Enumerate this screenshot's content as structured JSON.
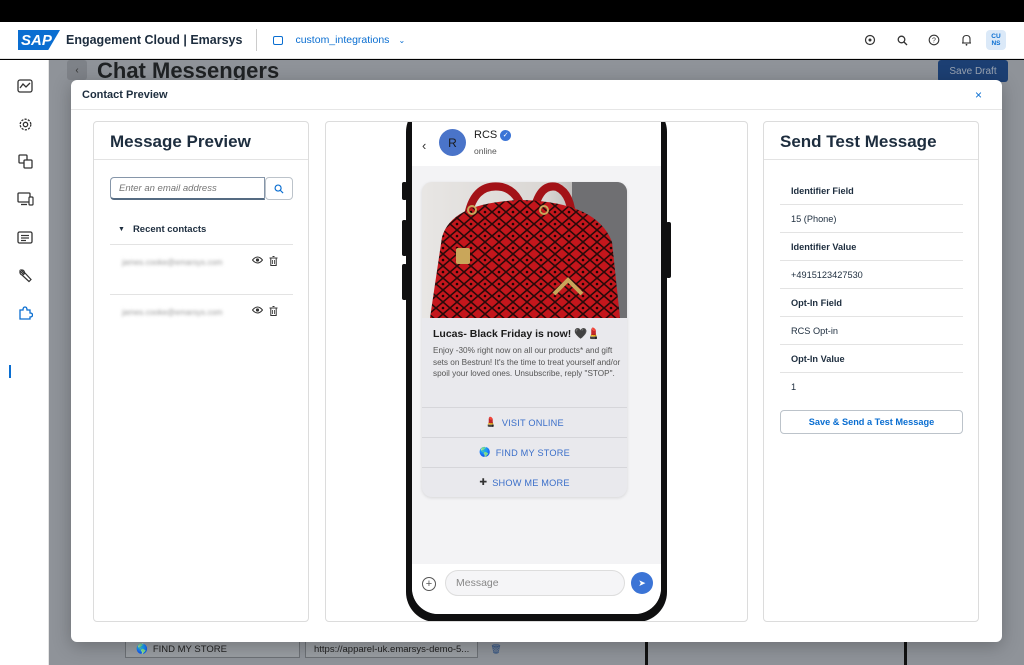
{
  "shell": {
    "logo_text": "SAP",
    "app_title": "Engagement Cloud | Emarsys",
    "context_label": "custom_integrations",
    "avatar_initials": "CU NS"
  },
  "background": {
    "page_title": "Chat Messengers",
    "save_draft_label": "Save Draft",
    "field_find_store": "FIND MY STORE",
    "field_url": "https://apparel-uk.emarsys-demo-5..."
  },
  "dialog": {
    "title": "Contact Preview",
    "close_label": "×"
  },
  "message_preview": {
    "title": "Message Preview",
    "search_placeholder": "Enter an email address",
    "recent_label": "Recent contacts",
    "contacts": [
      {
        "blurred": "james.cooke@emarsys.com"
      },
      {
        "blurred": "james.cooke@emarsys.com"
      }
    ]
  },
  "phone": {
    "sender_name": "RCS",
    "sender_initial": "R",
    "sender_status": "online",
    "card": {
      "title": "Lucas- Black Friday is now! 🖤💄",
      "description": "Enjoy -30% right now on all our products* and gift sets on Bestrun! It's the time to treat yourself and/or spoil your loved ones. Unsubscribe, reply \"STOP\".",
      "actions": [
        {
          "icon": "💄",
          "label": "VISIT ONLINE"
        },
        {
          "icon": "🌎",
          "label": "FIND MY STORE"
        },
        {
          "icon": "✚",
          "label": "SHOW ME MORE"
        }
      ]
    },
    "composer_placeholder": "Message"
  },
  "send_test": {
    "title": "Send Test Message",
    "rows": [
      {
        "text": "Identifier Field"
      },
      {
        "text": "15 (Phone)"
      },
      {
        "text": "Identifier Value"
      },
      {
        "text": "+4915123427530"
      },
      {
        "text": "Opt-In Field"
      },
      {
        "text": "RCS Opt-in"
      },
      {
        "text": "Opt-In Value"
      },
      {
        "text": "1"
      }
    ],
    "button_label": "Save & Send a Test Message"
  },
  "colors": {
    "accent": "#0a6ed1",
    "rcs_blue": "#3b74d6"
  }
}
